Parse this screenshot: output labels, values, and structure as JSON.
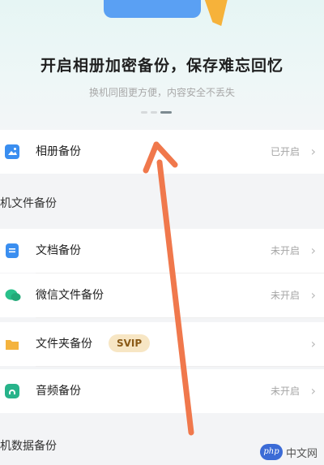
{
  "banner": {
    "title": "开启相册加密备份，保存难忘回忆",
    "subtitle": "换机同图更方便，内容安全不丢失",
    "carousel_dots": 3,
    "active_dot": 2
  },
  "rows": {
    "album": {
      "label": "相册备份",
      "status": "已开启",
      "icon": "image-icon"
    },
    "document": {
      "label": "文档备份",
      "status": "未开启",
      "icon": "document-icon"
    },
    "wechat": {
      "label": "微信文件备份",
      "status": "未开启",
      "icon": "wechat-icon"
    },
    "folder": {
      "label": "文件夹备份",
      "badge": "SVIP",
      "icon": "folder-icon"
    },
    "audio": {
      "label": "音频备份",
      "status": "未开启",
      "icon": "music-icon"
    }
  },
  "sections": {
    "file_backup": "机文件备份",
    "data_backup": "机数据备份"
  },
  "colors": {
    "album_icon": "#3a8ef0",
    "document_icon": "#3a8ef0",
    "wechat_icon": "#28c08a",
    "folder_icon": "#f4b33e",
    "audio_icon": "#27b38a",
    "arrow": "#f0784c",
    "svip_bg": "#f7e6c4"
  },
  "watermark": {
    "logo": "php",
    "text": "中文网"
  }
}
